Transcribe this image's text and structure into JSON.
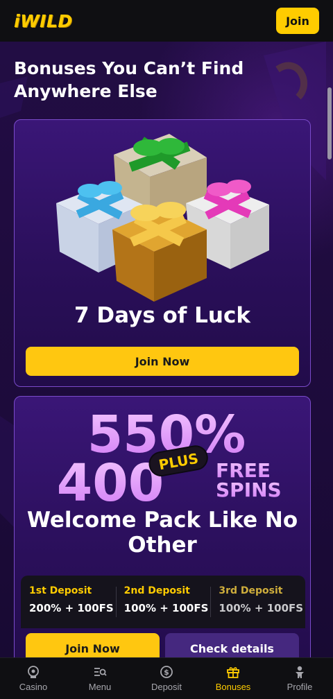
{
  "header": {
    "logo": "iWILD",
    "join_label": "Join"
  },
  "page": {
    "heading": "Bonuses You Can’t Find Anywhere Else"
  },
  "bonus_cards": [
    {
      "title": "7 Days of Luck",
      "button_label": "Join Now"
    },
    {
      "promo": {
        "percent": "550%",
        "plus": "PLUS",
        "spins": "400",
        "free": "FREE",
        "spins_word": "SPINS"
      },
      "title": "Welcome Pack Like No Other",
      "deposits": [
        {
          "title": "1st Deposit",
          "value": "200% + 100FS"
        },
        {
          "title": "2nd Deposit",
          "value": "100% + 100FS"
        },
        {
          "title": "3rd Deposit",
          "value": "100% + 100FS"
        }
      ],
      "button_label": "Join Now",
      "details_label": "Check details"
    }
  ],
  "bottom_nav": [
    {
      "label": "Casino",
      "icon": "casino-icon",
      "active": false
    },
    {
      "label": "Menu",
      "icon": "menu-search-icon",
      "active": false
    },
    {
      "label": "Deposit",
      "icon": "deposit-icon",
      "active": false
    },
    {
      "label": "Bonuses",
      "icon": "gift-icon",
      "active": true
    },
    {
      "label": "Profile",
      "icon": "profile-icon",
      "active": false
    }
  ],
  "colors": {
    "brand_yellow": "#ffcc00",
    "background": "#1a0b33",
    "card_border": "#7b4bcb",
    "secondary_button": "#45287f"
  }
}
